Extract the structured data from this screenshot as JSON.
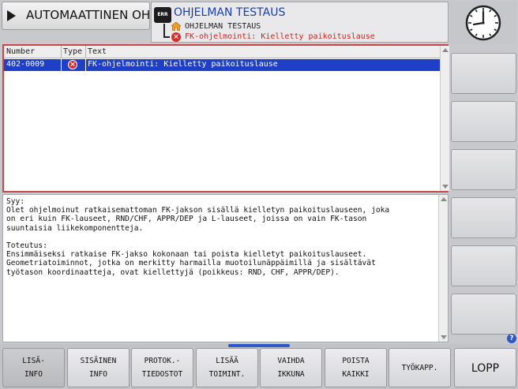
{
  "header": {
    "mode_label": "AUTOMAATTINEN OH...",
    "err_badge": "ERR",
    "program_title": "OHJELMAN TESTAUS",
    "program_name": "OHJELMAN TESTAUS",
    "current_error": "FK-ohjelmointi: Kielletty paikoituslause"
  },
  "error_table": {
    "columns": [
      "Number",
      "Type",
      "Text"
    ],
    "rows": [
      {
        "number": "402-0009",
        "type_icon": "error-icon",
        "text": "FK-ohjelmointi: Kielletty paikoituslause"
      }
    ]
  },
  "description": {
    "text": "Syy:\nOlet ohjelmoinut ratkaisemattoman FK-jakson sisällä kielletyn paikoituslauseen, joka\non eri kuin FK-lauseet, RND/CHF, APPR/DEP ja L-lauseet, joissa on vain FK-tason\nsuuntaisia liikekomponentteja.\n\nToteutus:\nEnsimmäiseksi ratkaise FK-jakso kokonaan tai poista kielletyt paikoituslauseet.\nGeometriatoiminnot, jotka on merkitty harmailla muotoilunäppäimillä ja sisältävät\ntyötason koordinaatteja, ovat kiellettyjä (poikkeus: RND, CHF, APPR/DEP)."
  },
  "help_icon": "?",
  "softkeys": [
    {
      "l1": "LISÄ-",
      "l2": "INFO"
    },
    {
      "l1": "SISÄINEN",
      "l2": "INFO"
    },
    {
      "l1": "PROTOK.-",
      "l2": "TIEDOSTOT"
    },
    {
      "l1": "LISÄÄ",
      "l2": "TOIMINT."
    },
    {
      "l1": "VAIHDA",
      "l2": "IKKUNA"
    },
    {
      "l1": "POISTA",
      "l2": "KAIKKI"
    },
    {
      "l1": "TYÖKAPP."
    },
    {
      "l1": "LOPP"
    }
  ],
  "colors": {
    "accent_blue": "#1f3fc6",
    "error_red": "#d62b2b",
    "title_blue": "#1b3fa7"
  }
}
